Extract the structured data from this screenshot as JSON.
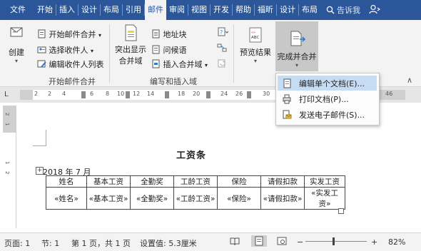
{
  "tabs": [
    {
      "label": "文件",
      "active": false
    },
    {
      "label": "开始",
      "active": false
    },
    {
      "label": "插入",
      "active": false
    },
    {
      "label": "设计",
      "active": false
    },
    {
      "label": "布局",
      "active": false
    },
    {
      "label": "引用",
      "active": false
    },
    {
      "label": "邮件",
      "active": true
    },
    {
      "label": "审阅",
      "active": false
    },
    {
      "label": "视图",
      "active": false
    },
    {
      "label": "开发",
      "active": false
    },
    {
      "label": "帮助",
      "active": false
    },
    {
      "label": "福昕",
      "active": false
    },
    {
      "label": "设计",
      "active": false
    },
    {
      "label": "布局",
      "active": false
    }
  ],
  "tell_me": "告诉我",
  "ribbon": {
    "create": "创建",
    "start_merge": "开始邮件合并",
    "select_recipients": "选择收件人",
    "edit_recipients": "编辑收件人列表",
    "group_start": "开始邮件合并",
    "highlight_fields_1": "突出显示",
    "highlight_fields_2": "合并域",
    "address_block": "地址块",
    "greeting_line": "问候语",
    "insert_merge_field": "插入合并域",
    "group_write": "编写和插入域",
    "preview_results": "预览结果",
    "preview_icon_text": "ABC",
    "finish_merge": "完成并合并"
  },
  "menu": {
    "items": [
      {
        "label": "编辑单个文档(E)...",
        "highlighted": true
      },
      {
        "label": "打印文档(P)...",
        "highlighted": false
      },
      {
        "label": "发送电子邮件(S)...",
        "highlighted": false
      }
    ]
  },
  "ruler": {
    "numbers": [
      "2",
      "2",
      "4",
      "6",
      "8",
      "10",
      "12",
      "14",
      "16",
      "18",
      "20",
      "22",
      "24",
      "26",
      "28",
      "30",
      "46"
    ],
    "vertical": [
      "2",
      "1",
      "1",
      "2"
    ]
  },
  "document": {
    "title": "工资条",
    "date": "2018 年 7 月",
    "headers": [
      "姓名",
      "基本工资",
      "全勤奖",
      "工龄工资",
      "保险",
      "请假扣款",
      "实发工资"
    ],
    "row": [
      "«姓名»",
      "«基本工资»",
      "«全勤奖»",
      "«工龄工资»",
      "«保险»",
      "«请假扣款»",
      "«实发工资»"
    ]
  },
  "status": {
    "page": "页面: 1",
    "section": "节: 1",
    "page_of": "第 1 页，共 1 页",
    "setting": "设置值: 5.3厘米",
    "zoom": "82%",
    "zoom_minus": "−",
    "zoom_plus": "+"
  },
  "colors": {
    "ribbon_bar": "#2b579a",
    "menu_highlight": "#c5dcf3",
    "ribbon_bg": "#f3f3f3"
  }
}
